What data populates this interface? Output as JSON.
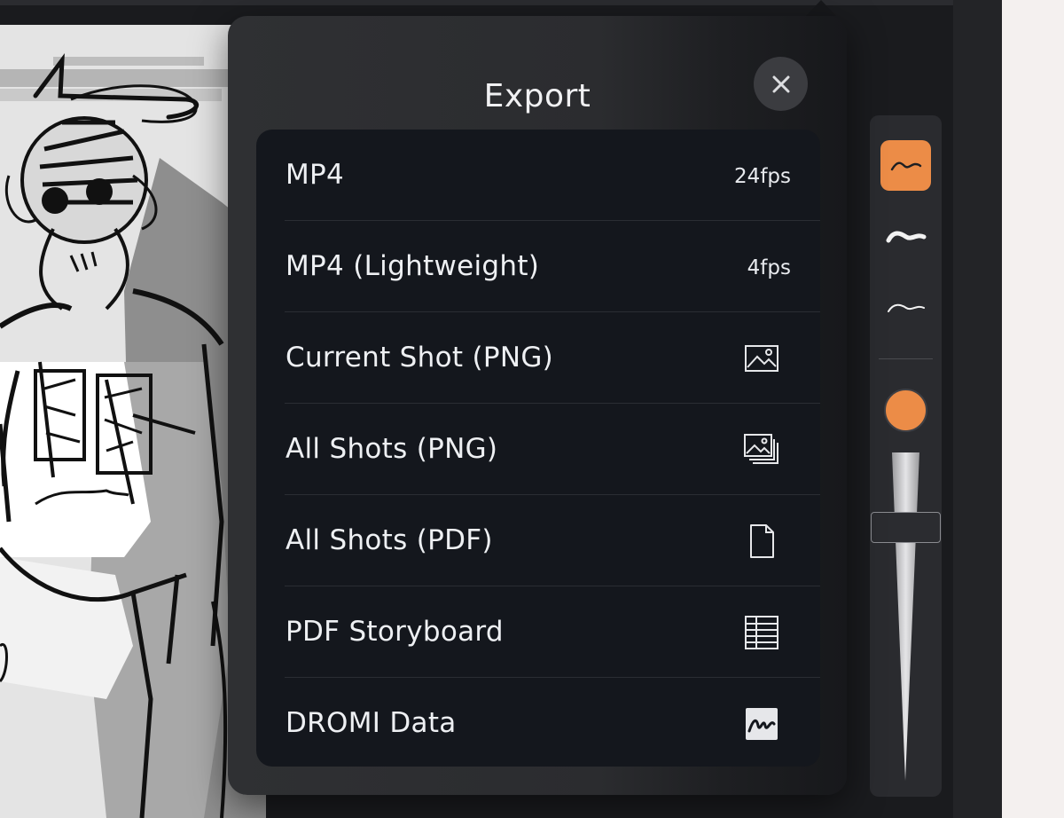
{
  "panel": {
    "title": "Export",
    "close_icon": "close-icon"
  },
  "export_options": [
    {
      "label": "MP4",
      "meta": "24fps",
      "icon": null
    },
    {
      "label": "MP4 (Lightweight)",
      "meta": "4fps",
      "icon": null
    },
    {
      "label": "Current Shot (PNG)",
      "meta": null,
      "icon": "image-icon"
    },
    {
      "label": "All Shots (PNG)",
      "meta": null,
      "icon": "images-stack-icon"
    },
    {
      "label": "All Shots (PDF)",
      "meta": null,
      "icon": "document-icon"
    },
    {
      "label": "PDF Storyboard",
      "meta": null,
      "icon": "grid-table-icon"
    },
    {
      "label": "DROMI Data",
      "meta": null,
      "icon": "dromi-data-icon"
    }
  ],
  "tool_palette": {
    "brushes": [
      {
        "name": "sketch-brush-icon",
        "active": true
      },
      {
        "name": "thick-brush-icon",
        "active": false
      },
      {
        "name": "thin-brush-icon",
        "active": false
      }
    ],
    "current_color": "#ec8c47",
    "brush_size_level": 0.2
  },
  "colors": {
    "accent": "#ec8c47",
    "panel_bg": "#2f3033",
    "list_bg": "#14171d"
  }
}
